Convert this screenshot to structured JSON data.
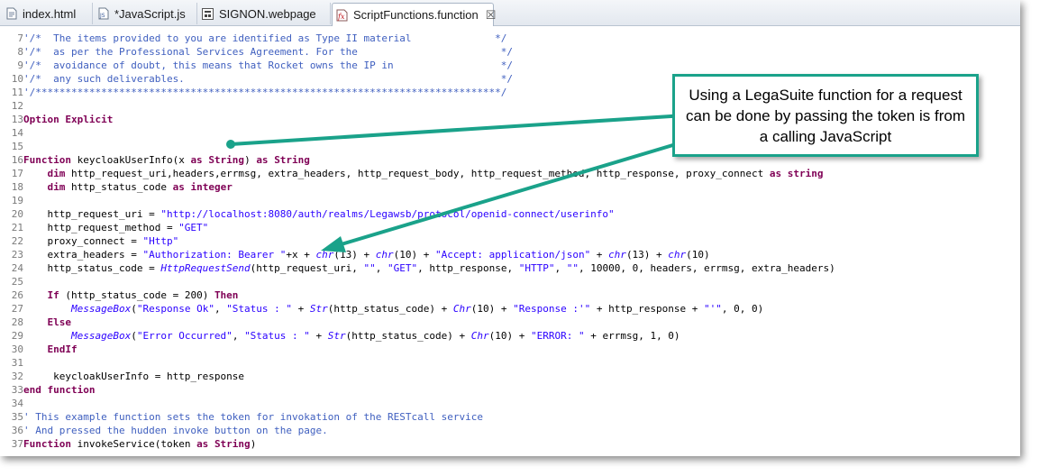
{
  "tabs": [
    {
      "label": "index.html",
      "icon": "html-file-icon",
      "active": false
    },
    {
      "label": "*JavaScript.js",
      "icon": "js-file-icon",
      "active": false
    },
    {
      "label": "SIGNON.webpage",
      "icon": "webpage-file-icon",
      "active": false
    },
    {
      "label": "ScriptFunctions.function",
      "icon": "function-file-icon",
      "active": true
    }
  ],
  "tab_close_glyph": "☒",
  "code_lines": [
    {
      "n": "7",
      "tokens": [
        {
          "t": "'/*  The items provided to you are identified as Type II material              */",
          "c": "cm"
        }
      ]
    },
    {
      "n": "8",
      "tokens": [
        {
          "t": "'/*  as per the Professional Services Agreement. For the                        */",
          "c": "cm"
        }
      ]
    },
    {
      "n": "9",
      "tokens": [
        {
          "t": "'/*  avoidance of doubt, this means that Rocket owns the IP in                  */",
          "c": "cm"
        }
      ]
    },
    {
      "n": "10",
      "tokens": [
        {
          "t": "'/*  any such deliverables.                                                     */",
          "c": "cm"
        }
      ]
    },
    {
      "n": "11",
      "tokens": [
        {
          "t": "'/******************************************************************************/",
          "c": "cm"
        }
      ]
    },
    {
      "n": "12",
      "tokens": []
    },
    {
      "n": "13",
      "tokens": [
        {
          "t": "Option Explicit",
          "c": "kw"
        }
      ]
    },
    {
      "n": "14",
      "tokens": []
    },
    {
      "n": "15",
      "tokens": []
    },
    {
      "n": "16",
      "tokens": [
        {
          "t": "Function",
          "c": "kw"
        },
        {
          "t": " keycloakUserInfo(x ",
          "c": ""
        },
        {
          "t": "as",
          "c": "kw"
        },
        {
          "t": " ",
          "c": ""
        },
        {
          "t": "String",
          "c": "kw"
        },
        {
          "t": ") ",
          "c": ""
        },
        {
          "t": "as",
          "c": "kw"
        },
        {
          "t": " ",
          "c": ""
        },
        {
          "t": "String",
          "c": "kw"
        }
      ]
    },
    {
      "n": "17",
      "tokens": [
        {
          "t": "    ",
          "c": ""
        },
        {
          "t": "dim",
          "c": "kw"
        },
        {
          "t": " http_request_uri,headers,errmsg, extra_headers, http_request_body, http_request_method, http_response, proxy_connect ",
          "c": ""
        },
        {
          "t": "as",
          "c": "kw"
        },
        {
          "t": " ",
          "c": ""
        },
        {
          "t": "string",
          "c": "kw"
        }
      ]
    },
    {
      "n": "18",
      "tokens": [
        {
          "t": "    ",
          "c": ""
        },
        {
          "t": "dim",
          "c": "kw"
        },
        {
          "t": " http_status_code ",
          "c": ""
        },
        {
          "t": "as",
          "c": "kw"
        },
        {
          "t": " ",
          "c": ""
        },
        {
          "t": "integer",
          "c": "kw"
        }
      ]
    },
    {
      "n": "19",
      "tokens": []
    },
    {
      "n": "20",
      "tokens": [
        {
          "t": "    http_request_uri = ",
          "c": ""
        },
        {
          "t": "\"http://localhost:8080/auth/realms/Legawsb/protocol/openid-connect/userinfo\"",
          "c": "st"
        }
      ]
    },
    {
      "n": "21",
      "tokens": [
        {
          "t": "    http_request_method = ",
          "c": ""
        },
        {
          "t": "\"GET\"",
          "c": "st"
        }
      ]
    },
    {
      "n": "22",
      "tokens": [
        {
          "t": "    proxy_connect = ",
          "c": ""
        },
        {
          "t": "\"Http\"",
          "c": "st"
        }
      ]
    },
    {
      "n": "23",
      "tokens": [
        {
          "t": "    extra_headers = ",
          "c": ""
        },
        {
          "t": "\"Authorization: Bearer \"",
          "c": "st"
        },
        {
          "t": "+x + ",
          "c": ""
        },
        {
          "t": "chr",
          "c": "fn"
        },
        {
          "t": "(13) + ",
          "c": ""
        },
        {
          "t": "chr",
          "c": "fn"
        },
        {
          "t": "(10) + ",
          "c": ""
        },
        {
          "t": "\"Accept: application/json\"",
          "c": "st"
        },
        {
          "t": " + ",
          "c": ""
        },
        {
          "t": "chr",
          "c": "fn"
        },
        {
          "t": "(13) + ",
          "c": ""
        },
        {
          "t": "chr",
          "c": "fn"
        },
        {
          "t": "(10)",
          "c": ""
        }
      ]
    },
    {
      "n": "24",
      "tokens": [
        {
          "t": "    http_status_code = ",
          "c": ""
        },
        {
          "t": "HttpRequestSend",
          "c": "fn"
        },
        {
          "t": "(http_request_uri, ",
          "c": ""
        },
        {
          "t": "\"\"",
          "c": "st"
        },
        {
          "t": ", ",
          "c": ""
        },
        {
          "t": "\"GET\"",
          "c": "st"
        },
        {
          "t": ", http_response, ",
          "c": ""
        },
        {
          "t": "\"HTTP\"",
          "c": "st"
        },
        {
          "t": ", ",
          "c": ""
        },
        {
          "t": "\"\"",
          "c": "st"
        },
        {
          "t": ", 10000, 0, headers, errmsg, extra_headers)",
          "c": ""
        }
      ]
    },
    {
      "n": "25",
      "tokens": []
    },
    {
      "n": "26",
      "tokens": [
        {
          "t": "    ",
          "c": ""
        },
        {
          "t": "If",
          "c": "kw"
        },
        {
          "t": " (http_status_code = 200) ",
          "c": ""
        },
        {
          "t": "Then",
          "c": "kw"
        }
      ]
    },
    {
      "n": "27",
      "tokens": [
        {
          "t": "        ",
          "c": ""
        },
        {
          "t": "MessageBox",
          "c": "fn"
        },
        {
          "t": "(",
          "c": ""
        },
        {
          "t": "\"Response Ok\"",
          "c": "st"
        },
        {
          "t": ", ",
          "c": ""
        },
        {
          "t": "\"Status : \"",
          "c": "st"
        },
        {
          "t": " + ",
          "c": ""
        },
        {
          "t": "Str",
          "c": "fn"
        },
        {
          "t": "(http_status_code) + ",
          "c": ""
        },
        {
          "t": "Chr",
          "c": "fn"
        },
        {
          "t": "(10) + ",
          "c": ""
        },
        {
          "t": "\"Response :'\"",
          "c": "st"
        },
        {
          "t": " + http_response + ",
          "c": ""
        },
        {
          "t": "\"'\"",
          "c": "st"
        },
        {
          "t": ", 0, 0)",
          "c": ""
        }
      ]
    },
    {
      "n": "28",
      "tokens": [
        {
          "t": "    ",
          "c": ""
        },
        {
          "t": "Else",
          "c": "kw"
        }
      ]
    },
    {
      "n": "29",
      "tokens": [
        {
          "t": "        ",
          "c": ""
        },
        {
          "t": "MessageBox",
          "c": "fn"
        },
        {
          "t": "(",
          "c": ""
        },
        {
          "t": "\"Error Occurred\"",
          "c": "st"
        },
        {
          "t": ", ",
          "c": ""
        },
        {
          "t": "\"Status : \"",
          "c": "st"
        },
        {
          "t": " + ",
          "c": ""
        },
        {
          "t": "Str",
          "c": "fn"
        },
        {
          "t": "(http_status_code) + ",
          "c": ""
        },
        {
          "t": "Chr",
          "c": "fn"
        },
        {
          "t": "(10) + ",
          "c": ""
        },
        {
          "t": "\"ERROR: \"",
          "c": "st"
        },
        {
          "t": " + errmsg, 1, 0)",
          "c": ""
        }
      ]
    },
    {
      "n": "30",
      "tokens": [
        {
          "t": "    ",
          "c": ""
        },
        {
          "t": "EndIf",
          "c": "kw"
        }
      ]
    },
    {
      "n": "31",
      "tokens": []
    },
    {
      "n": "32",
      "tokens": [
        {
          "t": "     keycloakUserInfo = http_response",
          "c": ""
        }
      ]
    },
    {
      "n": "33",
      "tokens": [
        {
          "t": "end function",
          "c": "kw"
        }
      ]
    },
    {
      "n": "34",
      "tokens": []
    },
    {
      "n": "35",
      "tokens": [
        {
          "t": "' This example function sets the token for invokation of the RESTcall service",
          "c": "cm"
        }
      ]
    },
    {
      "n": "36",
      "tokens": [
        {
          "t": "' And pressed the hudden invoke button on the page.",
          "c": "cm"
        }
      ]
    },
    {
      "n": "37",
      "tokens": [
        {
          "t": "Function",
          "c": "kw"
        },
        {
          "t": " invokeService(token ",
          "c": ""
        },
        {
          "t": "as",
          "c": "kw"
        },
        {
          "t": " ",
          "c": ""
        },
        {
          "t": "String",
          "c": "kw"
        },
        {
          "t": ")",
          "c": ""
        }
      ]
    }
  ],
  "callout": {
    "text": "Using a LegaSuite function for a request can be done by passing the token is from a calling JavaScript"
  },
  "colors": {
    "keyword": "#7f0055",
    "comment": "#3f5fbf",
    "string": "#2a00ff",
    "callout_border": "#1aa28a"
  }
}
